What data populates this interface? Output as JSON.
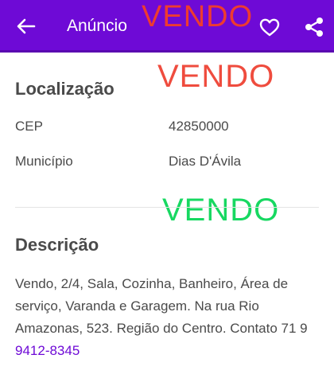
{
  "appbar": {
    "title": "Anúncio",
    "back_icon": "arrow-left-icon",
    "favorite_icon": "heart-outline-icon",
    "share_icon": "share-icon",
    "color": "#6e0ad6"
  },
  "overlays": {
    "stamp_1": "VENDO",
    "stamp_2": "VENDO",
    "stamp_3": "VENDO",
    "colors": [
      "#ee3b30",
      "#ef4c3e",
      "#17d861"
    ]
  },
  "location": {
    "title": "Localização",
    "cep_label": "CEP",
    "cep_value": "42850000",
    "municipality_label": "Município",
    "municipality_value": "Dias D'Ávila"
  },
  "description": {
    "title": "Descrição",
    "text": "Vendo, 2/4, Sala, Cozinha, Banheiro, Área de serviço, Varanda e Garagem. Na rua Rio Amazonas, 523. Região do Centro. Contato 71 9 ",
    "phone": "9412-8345",
    "phone_color": "#6e0ad6"
  }
}
